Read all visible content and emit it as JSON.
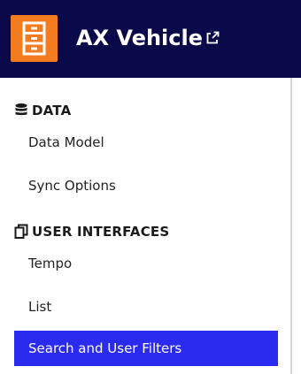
{
  "header": {
    "title": "AX Vehicle",
    "app_icon": "cabinet-icon",
    "link_icon": "external-link-icon",
    "background_color": "#0a0a4a",
    "app_icon_color": "#f47c20"
  },
  "sidebar": {
    "sections": [
      {
        "label": "DATA",
        "icon": "database-icon",
        "items": [
          {
            "label": "Data Model",
            "active": false
          },
          {
            "label": "Sync Options",
            "active": false
          }
        ]
      },
      {
        "label": "USER INTERFACES",
        "icon": "copy-icon",
        "items": [
          {
            "label": "Tempo",
            "active": false
          },
          {
            "label": "List",
            "active": false
          },
          {
            "label": "Search and User Filters",
            "active": true
          }
        ]
      }
    ],
    "active_color": "#2b2bf0"
  }
}
